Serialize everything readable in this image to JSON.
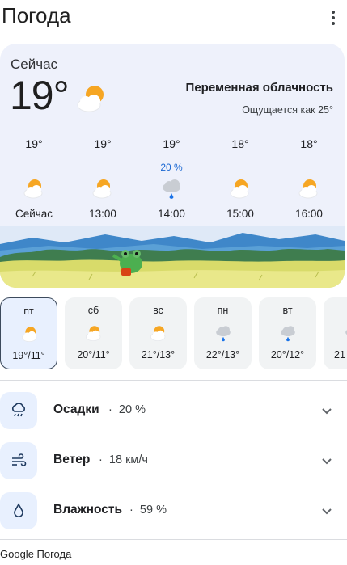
{
  "app": {
    "title": "Погода",
    "menu_icon": "more-vert-icon"
  },
  "current": {
    "label": "Сейчас",
    "temperature": "19°",
    "icon": "partly-cloudy-icon",
    "condition": "Переменная облачность",
    "feels_like": "Ощущается как 25°"
  },
  "hourly": [
    {
      "temp": "19°",
      "precip": "",
      "icon": "partly-cloudy-icon",
      "label": "Сейчас"
    },
    {
      "temp": "19°",
      "precip": "",
      "icon": "partly-cloudy-icon",
      "label": "13:00"
    },
    {
      "temp": "19°",
      "precip": "20 %",
      "icon": "rain-cloud-icon",
      "label": "14:00"
    },
    {
      "temp": "18°",
      "precip": "",
      "icon": "partly-cloudy-icon",
      "label": "15:00"
    },
    {
      "temp": "18°",
      "precip": "",
      "icon": "partly-cloudy-icon",
      "label": "16:00"
    }
  ],
  "daily": [
    {
      "day": "пт",
      "icon": "partly-cloudy-icon",
      "temps": "19°/11°",
      "selected": true
    },
    {
      "day": "сб",
      "icon": "partly-cloudy-icon",
      "temps": "20°/11°",
      "selected": false
    },
    {
      "day": "вс",
      "icon": "partly-cloudy-icon",
      "temps": "21°/13°",
      "selected": false
    },
    {
      "day": "пн",
      "icon": "rain-cloud-icon",
      "temps": "22°/13°",
      "selected": false
    },
    {
      "day": "вт",
      "icon": "rain-cloud-icon",
      "temps": "20°/12°",
      "selected": false
    },
    {
      "day": "",
      "icon": "rain-cloud-icon",
      "temps": "21",
      "selected": false
    }
  ],
  "metrics": [
    {
      "label": "Осадки",
      "value": "20 %",
      "icon": "precipitation-icon"
    },
    {
      "label": "Ветер",
      "value": "18 км/ч",
      "icon": "wind-icon"
    },
    {
      "label": "Влажность",
      "value": "59 %",
      "icon": "humidity-icon"
    }
  ],
  "metric_separator": "·",
  "footer": {
    "link": "Google Погода"
  },
  "colors": {
    "accent": "#1967d2",
    "card_bg": "#eef1fb",
    "sun": "#f6a623",
    "cloud": "#ffffff",
    "rain_cloud": "#c9cdd3"
  }
}
